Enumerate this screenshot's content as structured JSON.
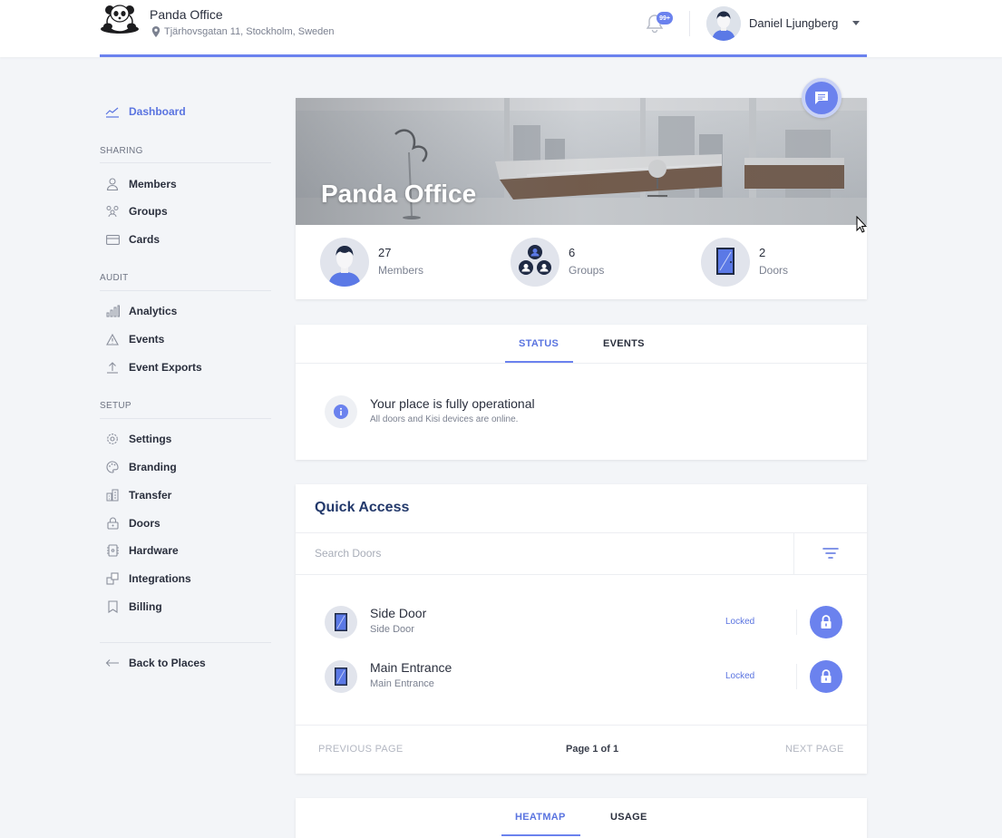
{
  "header": {
    "place_name": "Panda Office",
    "address": "Tjärhovsgatan 11, Stockholm, Sweden",
    "notification_badge": "99+",
    "user_name": "Daniel Ljungberg",
    "icons": [
      "panda-logo",
      "location-pin-icon",
      "bell-icon",
      "user-avatar",
      "chevron-down-icon"
    ]
  },
  "sidebar": {
    "dashboard": "Dashboard",
    "sections": {
      "sharing": "SHARING",
      "audit": "AUDIT",
      "setup": "SETUP"
    },
    "items": {
      "members": "Members",
      "groups": "Groups",
      "cards": "Cards",
      "analytics": "Analytics",
      "events": "Events",
      "event_exports": "Event Exports",
      "settings": "Settings",
      "branding": "Branding",
      "transfer": "Transfer",
      "doors": "Doors",
      "hardware": "Hardware",
      "integrations": "Integrations",
      "billing": "Billing"
    },
    "back": "Back to Places"
  },
  "hero": {
    "title": "Panda Office"
  },
  "stats": {
    "members": {
      "count": "27",
      "label": "Members"
    },
    "groups": {
      "count": "6",
      "label": "Groups"
    },
    "doors": {
      "count": "2",
      "label": "Doors"
    }
  },
  "status_card": {
    "tabs": [
      "STATUS",
      "EVENTS"
    ],
    "active_tab": "STATUS",
    "title": "Your place is fully operational",
    "subtitle": "All doors and Kisi devices are online."
  },
  "quick_access": {
    "title": "Quick Access",
    "search_placeholder": "Search Doors",
    "doors": [
      {
        "name": "Side Door",
        "sub": "Side Door",
        "status": "Locked"
      },
      {
        "name": "Main Entrance",
        "sub": "Main Entrance",
        "status": "Locked"
      }
    ],
    "pagination": {
      "prev": "PREVIOUS PAGE",
      "info": "Page 1 of 1",
      "next": "NEXT PAGE"
    }
  },
  "bottom_card": {
    "tabs": [
      "HEATMAP",
      "USAGE"
    ],
    "active_tab": "HEATMAP"
  },
  "colors": {
    "accent": "#6b82ee",
    "accent_text": "#5a74e0",
    "heading": "#23396b",
    "background": "#f3f5f8"
  }
}
